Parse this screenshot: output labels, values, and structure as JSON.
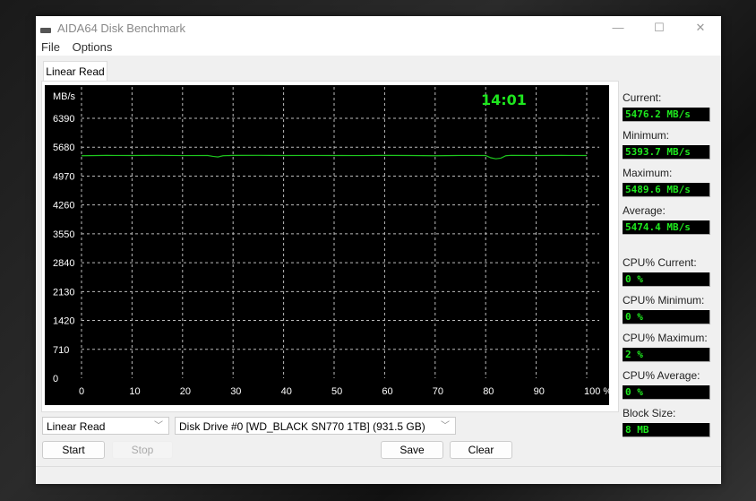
{
  "window": {
    "title": "AIDA64 Disk Benchmark",
    "minimize": "—",
    "maximize": "☐",
    "close": "✕"
  },
  "menu": [
    "File",
    "Options"
  ],
  "tab": "Linear Read",
  "chart_data": {
    "type": "line",
    "ylabel": "MB/s",
    "time_label": "14:01",
    "y_ticks": [
      0,
      710,
      1420,
      2130,
      2840,
      3550,
      4260,
      4970,
      5680,
      6390
    ],
    "x_ticks": [
      "0",
      "10",
      "20",
      "30",
      "40",
      "50",
      "60",
      "70",
      "80",
      "90",
      "100 %"
    ],
    "xlim": [
      0,
      100
    ],
    "ylim": [
      0,
      6390
    ],
    "line_color": "#1ec81e",
    "series": [
      {
        "name": "Linear Read",
        "x": [
          0,
          5,
          10,
          15,
          20,
          25,
          26,
          27,
          28,
          30,
          35,
          40,
          45,
          50,
          55,
          60,
          65,
          70,
          75,
          80,
          81,
          82,
          83,
          84,
          85,
          90,
          95,
          100
        ],
        "y": [
          5470,
          5478,
          5476,
          5480,
          5474,
          5476,
          5455,
          5440,
          5470,
          5478,
          5480,
          5475,
          5477,
          5476,
          5474,
          5478,
          5476,
          5470,
          5477,
          5476,
          5420,
          5394,
          5410,
          5470,
          5480,
          5476,
          5478,
          5476
        ]
      }
    ]
  },
  "stats": [
    {
      "label": "Current:",
      "value": "5476.2 MB/s"
    },
    {
      "label": "Minimum:",
      "value": "5393.7 MB/s"
    },
    {
      "label": "Maximum:",
      "value": "5489.6 MB/s"
    },
    {
      "label": "Average:",
      "value": "5474.4 MB/s"
    },
    {
      "label": "CPU% Current:",
      "value": "0 %"
    },
    {
      "label": "CPU% Minimum:",
      "value": "0 %"
    },
    {
      "label": "CPU% Maximum:",
      "value": "2 %"
    },
    {
      "label": "CPU% Average:",
      "value": "0 %"
    },
    {
      "label": "Block Size:",
      "value": "8 MB"
    }
  ],
  "controls": {
    "test": "Linear Read",
    "drive": "Disk Drive #0  [WD_BLACK SN770 1TB]  (931.5 GB)",
    "start": "Start",
    "stop": "Stop",
    "save": "Save",
    "clear": "Clear"
  }
}
